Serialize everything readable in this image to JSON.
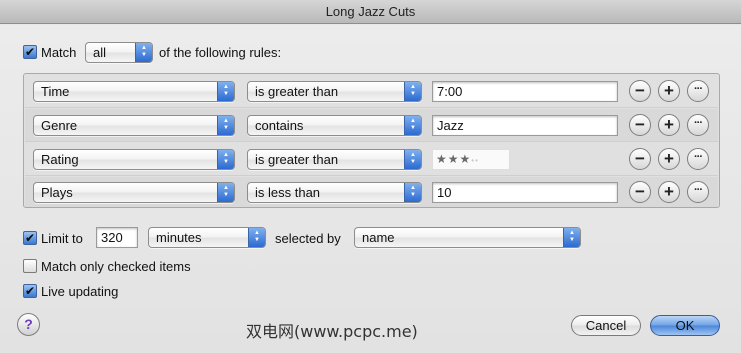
{
  "window": {
    "title": "Long Jazz Cuts"
  },
  "match": {
    "checked": true,
    "label": "Match",
    "mode": "all",
    "suffix": "of the following rules:"
  },
  "rules": [
    {
      "field": "Time",
      "operator": "is greater than",
      "value": "7:00",
      "type": "text"
    },
    {
      "field": "Genre",
      "operator": "contains",
      "value": "Jazz",
      "type": "text"
    },
    {
      "field": "Rating",
      "operator": "is greater than",
      "value_stars": 3,
      "value_stars_max": 5,
      "type": "stars"
    },
    {
      "field": "Plays",
      "operator": "is less than",
      "value": "10",
      "type": "text"
    }
  ],
  "limit": {
    "checked": true,
    "label": "Limit to",
    "value": "320",
    "unit": "minutes",
    "selected_by_label": "selected by",
    "selected_by": "name"
  },
  "options": {
    "match_checked_label": "Match only checked items",
    "match_checked": false,
    "live_updating_label": "Live updating",
    "live_updating": true
  },
  "buttons": {
    "help": "?",
    "cancel": "Cancel",
    "ok": "OK",
    "remove": "−",
    "add": "+",
    "more": "···"
  },
  "watermark": "双电网(www.pcpc.me)",
  "icons": {
    "checkmark": "✔",
    "popup_arrows": "popup-arrows-icon"
  }
}
